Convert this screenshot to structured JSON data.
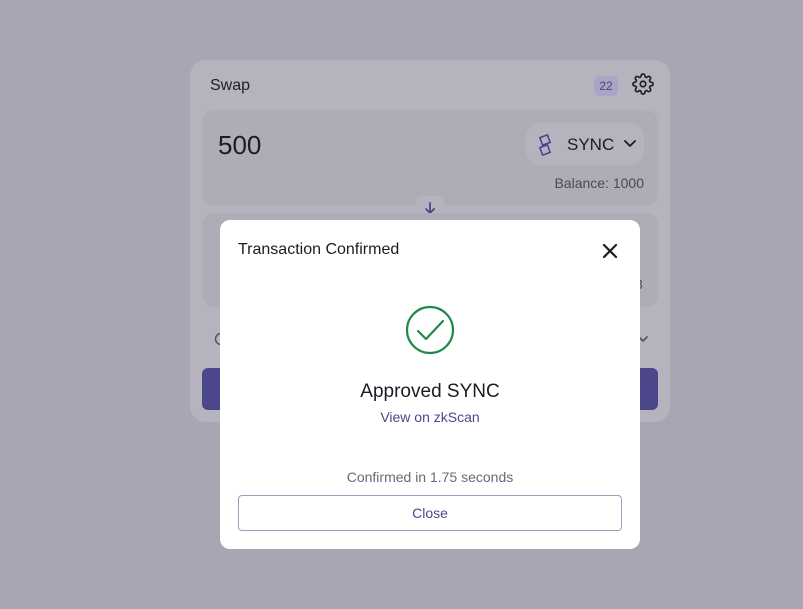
{
  "swap": {
    "title": "Swap",
    "badge": "22",
    "from": {
      "amount": "500",
      "token": "SYNC",
      "balance": "Balance: 1000"
    },
    "to": {
      "balance_peek": "3"
    },
    "colors": {
      "accent": "#4b478a",
      "backdrop": "#a7a6b2"
    }
  },
  "modal": {
    "title": "Transaction Confirmed",
    "status": "Approved SYNC",
    "link": "View on zkScan",
    "confirmed_time": "Confirmed in 1.75 seconds",
    "close_label": "Close",
    "colors": {
      "success": "#1f8a4c",
      "link": "#4b478a"
    }
  }
}
